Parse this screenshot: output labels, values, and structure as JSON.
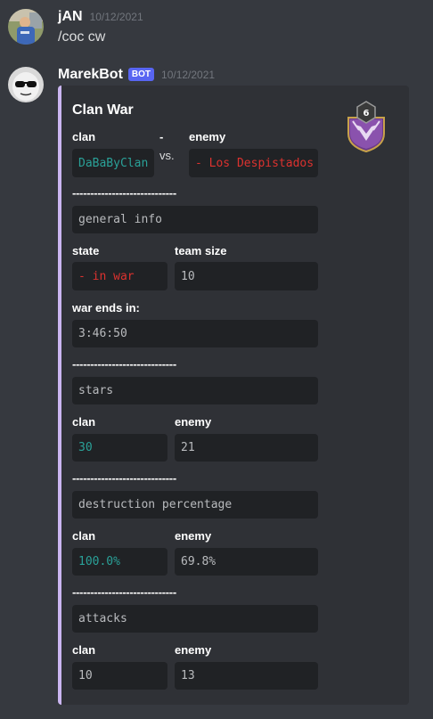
{
  "messages": [
    {
      "username": "jAN",
      "timestamp": "10/12/2021",
      "content": "/coc cw"
    },
    {
      "username": "MarekBot",
      "bot_tag": "BOT",
      "timestamp": "10/12/2021"
    }
  ],
  "embed": {
    "title": "Clan War",
    "accent_color": "#cbb6f1",
    "thumbnail_icon": "clan-badge-icon",
    "thumbnail_level": "6",
    "header": {
      "left_label": "clan",
      "left_value": "DaBaByClan",
      "middle_label": "-",
      "middle_value": "vs.",
      "right_label": "enemy",
      "right_value": "- Los Despistados"
    },
    "separator": "-----------------------------",
    "sections": {
      "general": {
        "title": "general info",
        "state_label": "state",
        "state_value": "- in war",
        "size_label": "team size",
        "size_value": "10",
        "ends_label": "war ends in:",
        "ends_value": "3:46:50"
      },
      "stars": {
        "title": "stars",
        "clan_label": "clan",
        "clan_value": "30",
        "enemy_label": "enemy",
        "enemy_value": "21"
      },
      "destruction": {
        "title": "destruction percentage",
        "clan_label": "clan",
        "clan_value": "100.0%",
        "enemy_label": "enemy",
        "enemy_value": "69.8%"
      },
      "attacks": {
        "title": "attacks",
        "clan_label": "clan",
        "clan_value": "10",
        "enemy_label": "enemy",
        "enemy_value": "13"
      }
    }
  }
}
